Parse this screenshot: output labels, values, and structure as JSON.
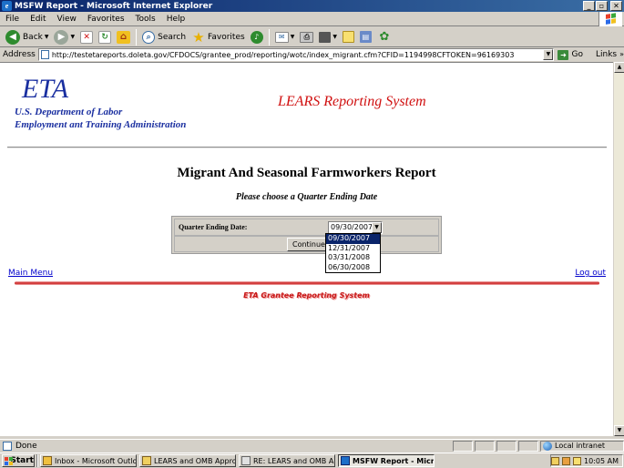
{
  "window": {
    "title": "MSFW Report - Microsoft Internet Explorer",
    "controls": [
      "_",
      "▫",
      "✕"
    ]
  },
  "menubar": [
    "File",
    "Edit",
    "View",
    "Favorites",
    "Tools",
    "Help"
  ],
  "toolbar": {
    "back": "Back",
    "search": "Search",
    "favorites": "Favorites"
  },
  "address": {
    "label": "Address",
    "url": "http://testetareports.doleta.gov/CFDOCS/grantee_prod/reporting/wotc/index_migrant.cfm?CFID=1194998CFTOKEN=96169303",
    "go": "Go",
    "links": "Links"
  },
  "page": {
    "logo": "ETA",
    "dept_line1": "U.S. Department of Labor",
    "dept_line2": "Employment ant Training Administration",
    "system_name": "LEARS Reporting System",
    "title": "Migrant And Seasonal Farmworkers Report",
    "subtitle": "Please choose a Quarter Ending Date",
    "form": {
      "label": "Quarter Ending Date:",
      "selected": "09/30/2007",
      "options": [
        "09/30/2007",
        "12/31/2007",
        "03/31/2008",
        "06/30/2008"
      ],
      "continue": "Continue"
    },
    "main_menu": "Main Menu",
    "logout": "Log out",
    "footer": "ETA Grantee Reporting System"
  },
  "status": {
    "text": "Done",
    "zone": "Local intranet"
  },
  "taskbar": {
    "start": "Start",
    "tasks": [
      {
        "label": "Inbox - Microsoft Outlook",
        "active": false
      },
      {
        "label": "LEARS and OMB Approv...",
        "active": false
      },
      {
        "label": "RE: LEARS and OMB Ap...",
        "active": false
      },
      {
        "label": "MSFW Report - Micr...",
        "active": true
      }
    ],
    "clock": "10:05 AM"
  },
  "colors": {
    "link": "#0000cc",
    "header_blue": "#1a2fa0",
    "accent_red": "#d01010",
    "titlebar": "#0a246a"
  }
}
